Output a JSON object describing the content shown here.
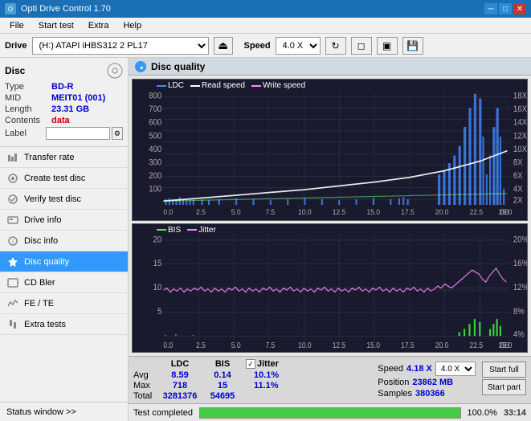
{
  "titlebar": {
    "title": "Opti Drive Control 1.70",
    "minimize": "─",
    "maximize": "□",
    "close": "✕"
  },
  "menu": {
    "items": [
      "File",
      "Start test",
      "Extra",
      "Help"
    ]
  },
  "drivebar": {
    "label": "Drive",
    "drive_value": "(H:) ATAPI iHBS312  2 PL17",
    "speed_label": "Speed",
    "speed_value": "4.0 X"
  },
  "disc": {
    "title": "Disc",
    "type_label": "Type",
    "type_value": "BD-R",
    "mid_label": "MID",
    "mid_value": "MEIT01 (001)",
    "length_label": "Length",
    "length_value": "23.31 GB",
    "contents_label": "Contents",
    "contents_value": "data",
    "label_label": "Label",
    "label_value": ""
  },
  "sidebar": {
    "items": [
      {
        "id": "transfer-rate",
        "label": "Transfer rate",
        "icon": "📊"
      },
      {
        "id": "create-test-disc",
        "label": "Create test disc",
        "icon": "💿"
      },
      {
        "id": "verify-test-disc",
        "label": "Verify test disc",
        "icon": "✓"
      },
      {
        "id": "drive-info",
        "label": "Drive info",
        "icon": "ℹ"
      },
      {
        "id": "disc-info",
        "label": "Disc info",
        "icon": "📀"
      },
      {
        "id": "disc-quality",
        "label": "Disc quality",
        "icon": "★",
        "active": true
      },
      {
        "id": "cd-bler",
        "label": "CD Bler",
        "icon": "📋"
      },
      {
        "id": "fe-te",
        "label": "FE / TE",
        "icon": "📈"
      },
      {
        "id": "extra-tests",
        "label": "Extra tests",
        "icon": "🔧"
      }
    ],
    "status_window": "Status window >>"
  },
  "content": {
    "title": "Disc quality",
    "chart1": {
      "legend": [
        {
          "label": "LDC",
          "color": "#4488ff"
        },
        {
          "label": "Read speed",
          "color": "#ffffff"
        },
        {
          "label": "Write speed",
          "color": "#ff88ff"
        }
      ],
      "y_max": 800,
      "y_labels": [
        "800",
        "700",
        "600",
        "500",
        "400",
        "300",
        "200",
        "100"
      ],
      "y_right": [
        "18X",
        "16X",
        "14X",
        "12X",
        "10X",
        "8X",
        "6X",
        "4X",
        "2X"
      ],
      "x_labels": [
        "0.0",
        "2.5",
        "5.0",
        "7.5",
        "10.0",
        "12.5",
        "15.0",
        "17.5",
        "20.0",
        "22.5",
        "25.0"
      ]
    },
    "chart2": {
      "legend": [
        {
          "label": "BIS",
          "color": "#44ff44"
        },
        {
          "label": "Jitter",
          "color": "#ff88ff"
        }
      ],
      "y_max": 20,
      "y_labels": [
        "20",
        "15",
        "10",
        "5"
      ],
      "y_right": [
        "20%",
        "16%",
        "12%",
        "8%",
        "4%"
      ],
      "x_labels": [
        "0.0",
        "2.5",
        "5.0",
        "7.5",
        "10.0",
        "12.5",
        "15.0",
        "17.5",
        "20.0",
        "22.5",
        "25.0"
      ]
    }
  },
  "stats": {
    "ldc_header": "LDC",
    "bis_header": "BIS",
    "jitter_label": "Jitter",
    "jitter_checked": true,
    "speed_label": "Speed",
    "speed_value": "4.18 X",
    "speed_select": "4.0 X",
    "avg_label": "Avg",
    "avg_ldc": "8.59",
    "avg_bis": "0.14",
    "avg_jitter": "10.1%",
    "max_label": "Max",
    "max_ldc": "718",
    "max_bis": "15",
    "max_jitter": "11.1%",
    "total_label": "Total",
    "total_ldc": "3281376",
    "total_bis": "54695",
    "position_label": "Position",
    "position_value": "23862 MB",
    "samples_label": "Samples",
    "samples_value": "380366",
    "start_full": "Start full",
    "start_part": "Start part"
  },
  "progress": {
    "percent": 100,
    "text": "Test completed",
    "time": "33:14"
  }
}
